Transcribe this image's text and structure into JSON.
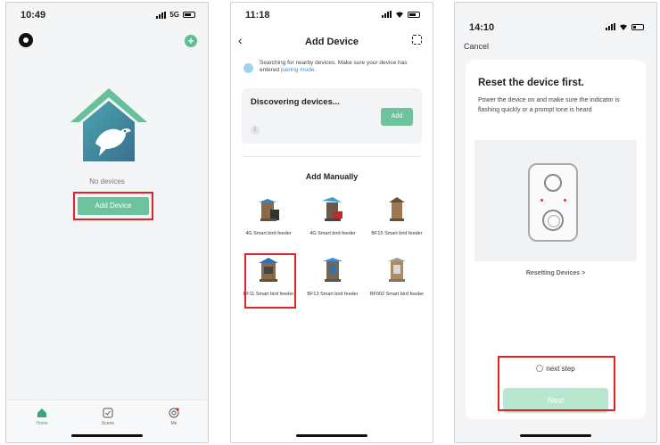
{
  "colors": {
    "accent": "#6cc39d",
    "highlight": "#e02424",
    "link": "#3a8fd8"
  },
  "screen_home": {
    "status_time": "10:49",
    "status_network": "5G",
    "empty_text": "No devices",
    "add_device_label": "Add Device",
    "tabs": [
      {
        "label": "Home",
        "icon": "home-icon"
      },
      {
        "label": "Scene",
        "icon": "checkbox-icon"
      },
      {
        "label": "Me",
        "icon": "profile-icon"
      }
    ]
  },
  "screen_add": {
    "status_time": "11:18",
    "title": "Add Device",
    "searching_text": "Searching for nearby devices. Make sure your device has entered ",
    "pairing_link": "pairing mode",
    "searching_suffix": ".",
    "discovering_title": "Discovering devices...",
    "discover_add_label": "Add",
    "manual_title": "Add Manually",
    "devices": [
      {
        "label": "4G Smart bird feeder"
      },
      {
        "label": "4G Smart bird feeder"
      },
      {
        "label": "BF15 Smart bird feeder"
      },
      {
        "label": "BF11 Smart bird feeder"
      },
      {
        "label": "BF13 Smart bird feeder"
      },
      {
        "label": "BF002 Smart bird feeder"
      }
    ]
  },
  "screen_reset": {
    "status_time": "14:10",
    "cancel_label": "Cancel",
    "title": "Reset the device first.",
    "description": "Power the device on and make sure the indicator is flashing quickly or a prompt tone is heard",
    "resetting_link": "Resetting Devices >",
    "next_step_label": "next step",
    "next_label": "Next"
  }
}
